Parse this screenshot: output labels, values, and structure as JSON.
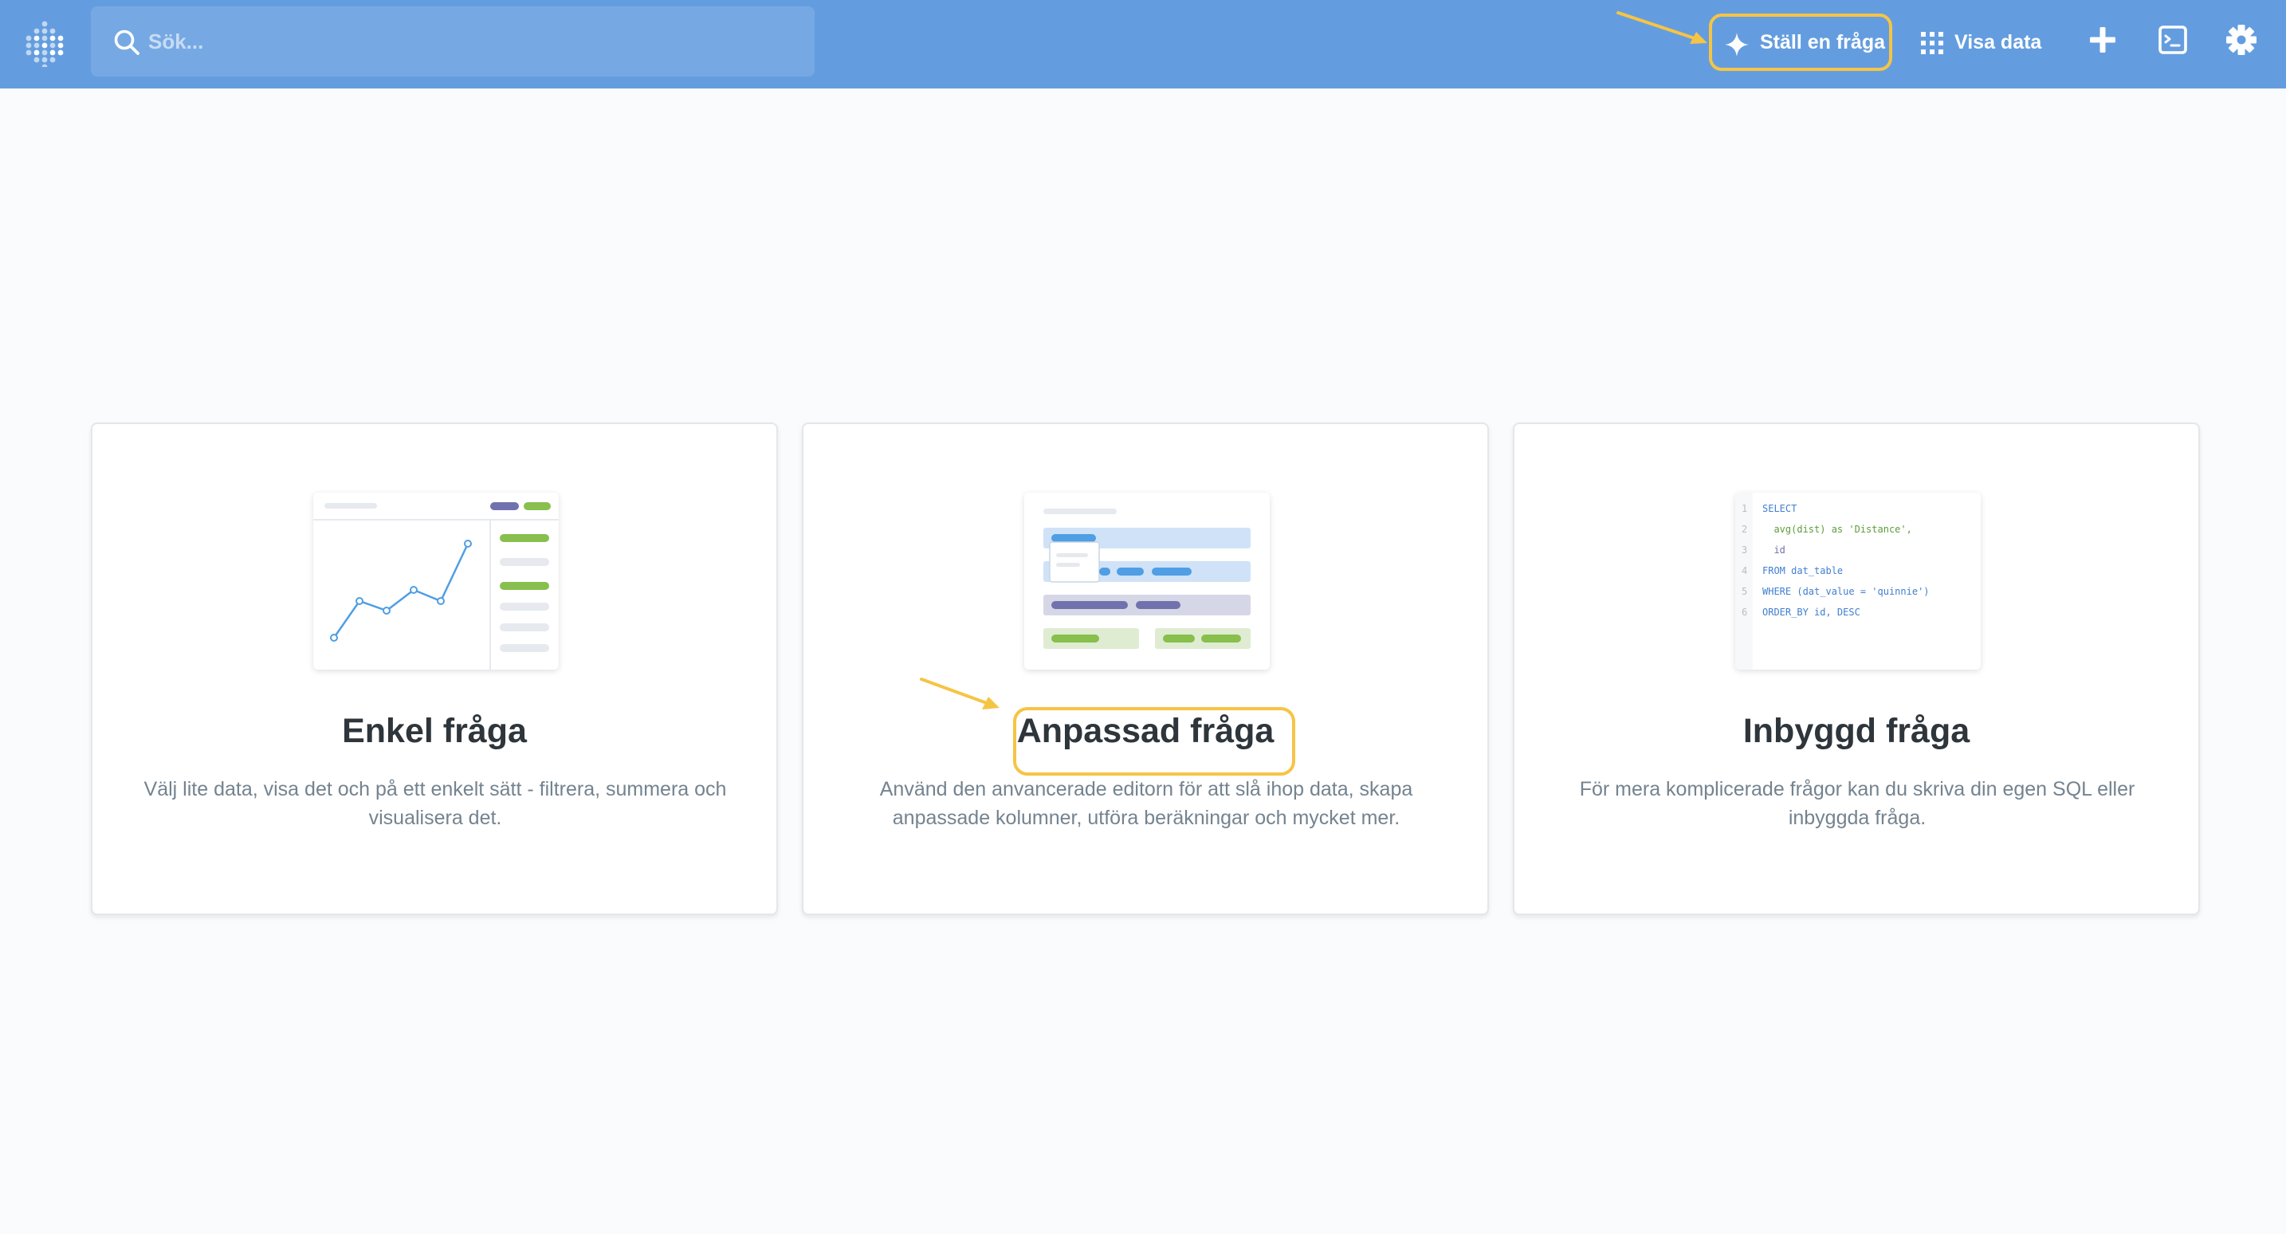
{
  "header": {
    "search_placeholder": "Sök...",
    "ask_question_label": "Ställ en fråga",
    "browse_data_label": "Visa data"
  },
  "cards": [
    {
      "title": "Enkel fråga",
      "description": "Välj lite data, visa det och på ett enkelt sätt - filtrera, summera och visualisera det."
    },
    {
      "title": "Anpassad fråga",
      "description": "Använd den anvancerade editorn för att slå ihop data, skapa anpassade kolumner, utföra beräkningar och mycket mer."
    },
    {
      "title": "Inbyggd fråga",
      "description": "För mera komplicerade frågor kan du skriva din egen SQL eller inbyggda fråga."
    }
  ],
  "sql_illustration": {
    "line_numbers": [
      "1",
      "2",
      "3",
      "4",
      "5",
      "6"
    ],
    "lines": [
      "SELECT",
      "  avg(dist) as 'Distance',",
      "  id",
      "FROM dat_table",
      "WHERE (dat_value = 'quinnie')",
      "ORDER_BY id, DESC"
    ]
  },
  "colors": {
    "topbar": "#649ddf",
    "highlight": "#f6c445",
    "brand_blue": "#509ee3",
    "green": "#88bf4d",
    "purple": "#7172ad"
  }
}
